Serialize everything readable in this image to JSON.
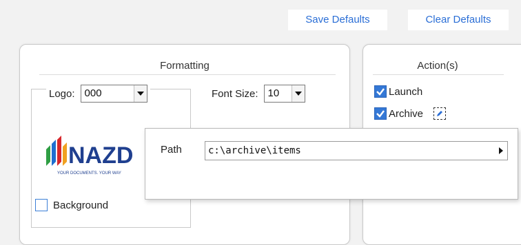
{
  "toolbar": {
    "save_defaults": "Save Defaults",
    "clear_defaults": "Clear Defaults"
  },
  "formatting": {
    "title": "Formatting",
    "logo_label": "Logo:",
    "logo_value": "000",
    "font_size_label": "Font Size:",
    "font_size_value": "10",
    "background_label": "Background",
    "background_checked": false,
    "logo_image": {
      "brand_text": "NAZD",
      "tagline": "YOUR DOCUMENTS. YOUR WAY"
    }
  },
  "actions": {
    "title": "Action(s)",
    "items": [
      {
        "label": "Launch",
        "checked": true
      },
      {
        "label": "Archive",
        "checked": true
      }
    ]
  },
  "path_popup": {
    "label": "Path",
    "value": "c:\\archive\\items"
  },
  "colors": {
    "link": "#2a6ed6",
    "checkbox_checked": "#3478d6",
    "logo_dark_blue": "#1f3f8f"
  }
}
